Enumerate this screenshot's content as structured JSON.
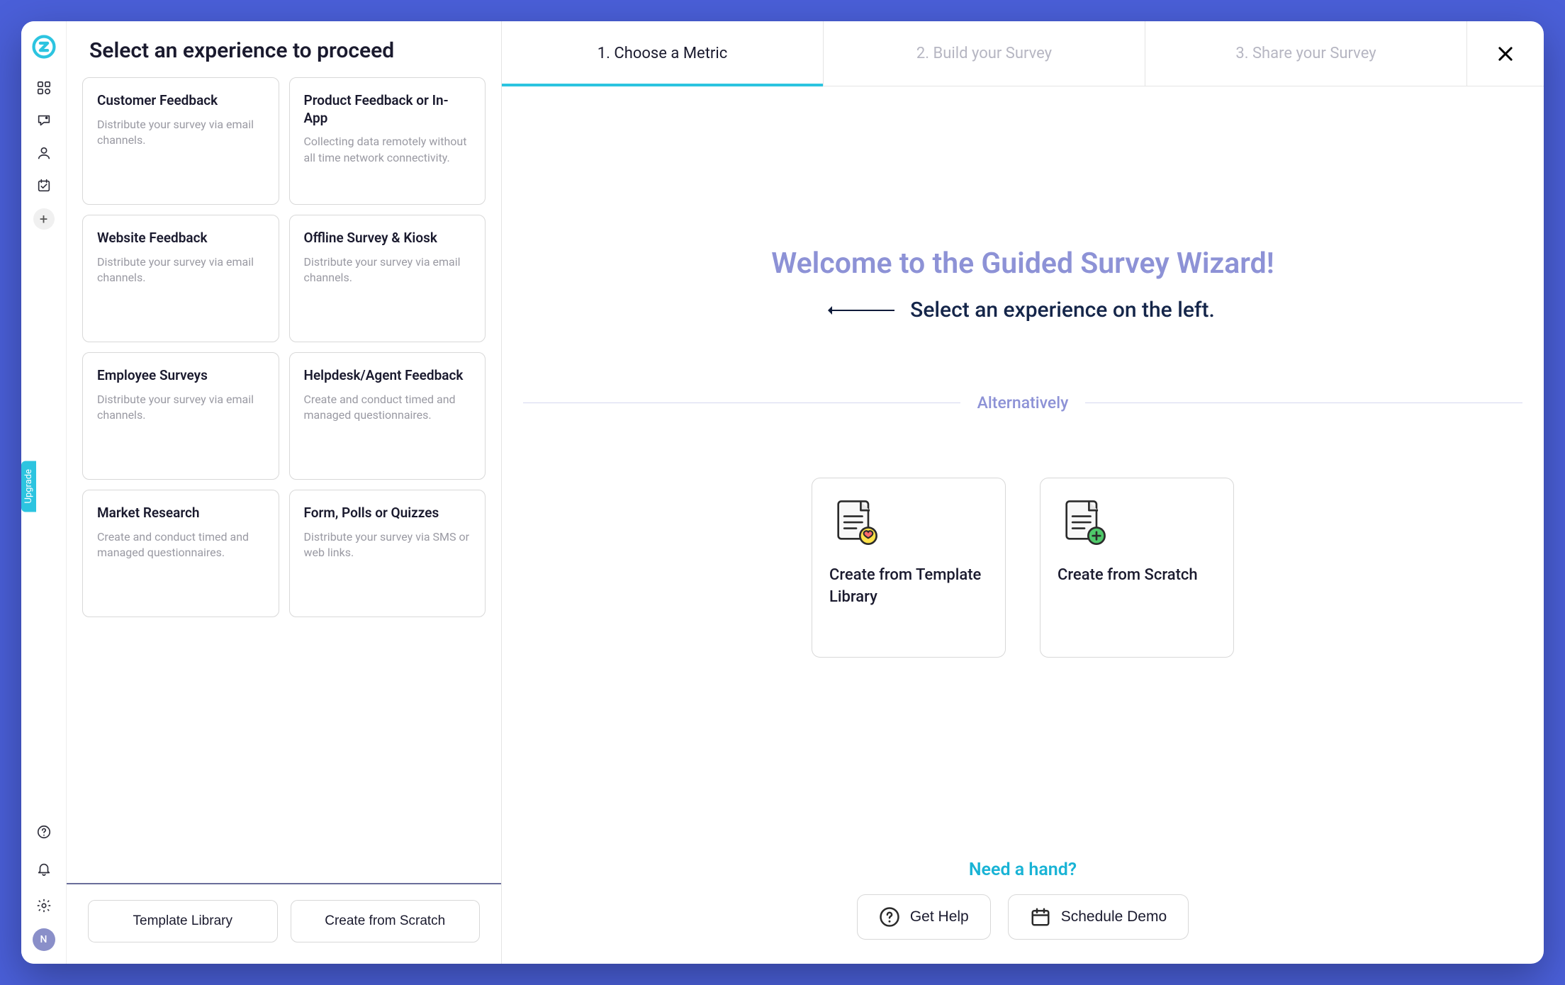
{
  "nav": {
    "upgrade_label": "Upgrade",
    "avatar_initial": "N"
  },
  "panel": {
    "title": "Select an experience to proceed",
    "experiences": [
      {
        "title": "Customer Feedback",
        "desc": "Distribute your survey via email channels."
      },
      {
        "title": "Product Feedback or In-App",
        "desc": "Collecting data remotely without all time network connectivity."
      },
      {
        "title": "Website Feedback",
        "desc": "Distribute your survey via email channels."
      },
      {
        "title": "Offline Survey & Kiosk",
        "desc": "Distribute your survey via email channels."
      },
      {
        "title": "Employee Surveys",
        "desc": "Distribute your survey via email channels."
      },
      {
        "title": "Helpdesk/Agent Feedback",
        "desc": "Create and conduct timed and managed questionnaires."
      },
      {
        "title": "Market Research",
        "desc": "Create and conduct timed and managed questionnaires."
      },
      {
        "title": "Form, Polls or Quizzes",
        "desc": "Distribute your survey via SMS or web links."
      }
    ],
    "footer_buttons": {
      "template_library": "Template Library",
      "from_scratch": "Create from Scratch"
    }
  },
  "steps": [
    {
      "label": "1. Choose a Metric",
      "active": true
    },
    {
      "label": "2. Build your Survey",
      "active": false
    },
    {
      "label": "3. Share your Survey",
      "active": false
    }
  ],
  "wizard": {
    "welcome": "Welcome to the Guided Survey Wizard!",
    "subtitle": "Select an experience on the left.",
    "alt_label": "Alternatively",
    "alt_cards": [
      {
        "title": "Create from Template Library"
      },
      {
        "title": "Create from Scratch"
      }
    ]
  },
  "help": {
    "title": "Need a hand?",
    "get_help": "Get Help",
    "schedule_demo": "Schedule Demo"
  }
}
